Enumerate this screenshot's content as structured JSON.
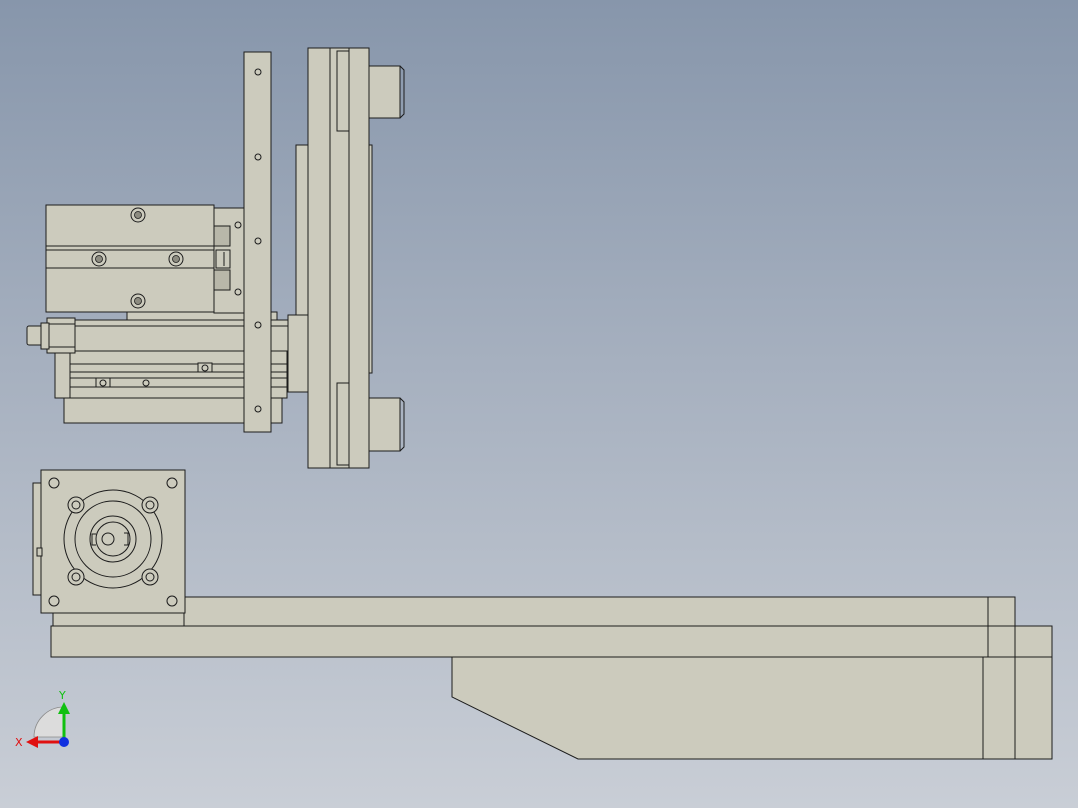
{
  "viewport": {
    "background_top": "#8796ab",
    "background_bottom": "#c9ced6",
    "part_color": "#cccbbd",
    "edge_color": "#1c1c1c"
  },
  "triad": {
    "x_label": "X",
    "y_label": "Y",
    "x_color": "#e01010",
    "y_color": "#10c010",
    "z_color": "#1030e0"
  }
}
